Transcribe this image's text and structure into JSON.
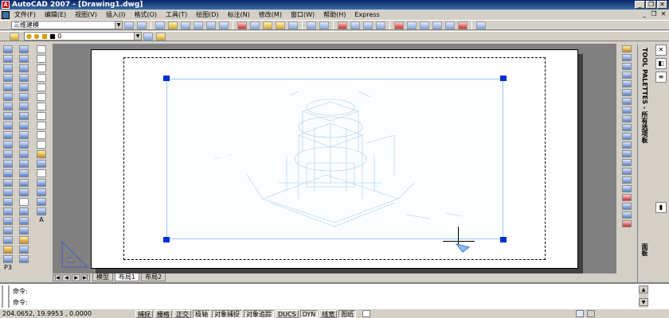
{
  "window": {
    "title": "AutoCAD 2007 - [Drawing1.dwg]"
  },
  "menu": [
    "文件(F)",
    "编辑(E)",
    "视图(V)",
    "插入(I)",
    "格式(O)",
    "工具(T)",
    "绘图(D)",
    "标注(N)",
    "修改(M)",
    "窗口(W)",
    "帮助(H)",
    "Express"
  ],
  "toolbar": {
    "workspace_value": "三维建模",
    "layer_value": "0"
  },
  "tabs": {
    "model": "模型",
    "layout1": "布局1",
    "layout2": "布局2"
  },
  "left_toolbar_text": {
    "label_text": "A",
    "p3d": "P3"
  },
  "palette": {
    "title": "TOOL PALETTES - 所有选项板",
    "bottom_label": "面板"
  },
  "command": {
    "line1": "命令:",
    "line2": "命令:"
  },
  "status": {
    "coords": "204.0652, 19.9953 , 0.0000",
    "buttons": [
      {
        "label": "捕捉",
        "on": false
      },
      {
        "label": "栅格",
        "on": false
      },
      {
        "label": "正交",
        "on": false
      },
      {
        "label": "极轴",
        "on": true
      },
      {
        "label": "对象捕捉",
        "on": true
      },
      {
        "label": "对象追踪",
        "on": true
      },
      {
        "label": "DUCS",
        "on": false
      },
      {
        "label": "DYN",
        "on": true
      },
      {
        "label": "线宽",
        "on": false
      },
      {
        "label": "图纸",
        "on": true
      }
    ]
  },
  "colors": {
    "title_bar": "#0a246a",
    "grip": "#0030d8",
    "viewport_border": "#a0c8f0",
    "drawing": "#bcd8ec"
  }
}
